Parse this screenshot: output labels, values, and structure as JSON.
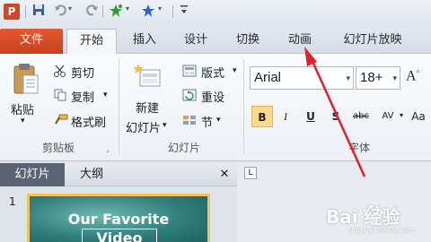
{
  "qat": {
    "app_icon": "P",
    "save_icon": "save-icon",
    "undo_icon": "undo-icon",
    "redo_icon": "redo-icon",
    "icons": [
      "powerpoint-app-icon",
      "save-icon",
      "undo-icon",
      "redo-icon",
      "sparkle-star-icon",
      "star-icon",
      "customize-toolbar-icon"
    ]
  },
  "tabs": [
    "文件",
    "开始",
    "插入",
    "设计",
    "切换",
    "动画",
    "幻灯片放映"
  ],
  "clipboard": {
    "paste": "粘贴",
    "cut": "剪切",
    "copy": "复制",
    "format_painter": "格式刷",
    "group": "剪贴板"
  },
  "slides": {
    "new_slide_line1": "新建",
    "new_slide_line2": "幻灯片",
    "layout": "版式",
    "reset": "重设",
    "section": "节",
    "group": "幻灯片"
  },
  "font": {
    "family": "Arial",
    "size": "18+",
    "bold": "B",
    "italic": "I",
    "underline": "U",
    "shadow": "S",
    "strikethrough": "abc",
    "spacing": "AV",
    "case": "Aa",
    "grow": "A",
    "group": "字体"
  },
  "pane": {
    "tab_slides": "幻灯片",
    "tab_outline": "大纲",
    "close": "✕",
    "slide_number": "1",
    "thumb_title_line1": "Our Favorite",
    "thumb_title_line2": "Video"
  },
  "editor": {
    "ruler_marker": "L"
  },
  "watermark": {
    "text": "Bai 经验",
    "sub": "jingyan.baidu.com"
  },
  "colors": {
    "file_tab": "#d24726",
    "selected_button": "#fbd98b",
    "annotation_arrow": "#e0202a",
    "thumbnail_border": "#f3c35b"
  }
}
